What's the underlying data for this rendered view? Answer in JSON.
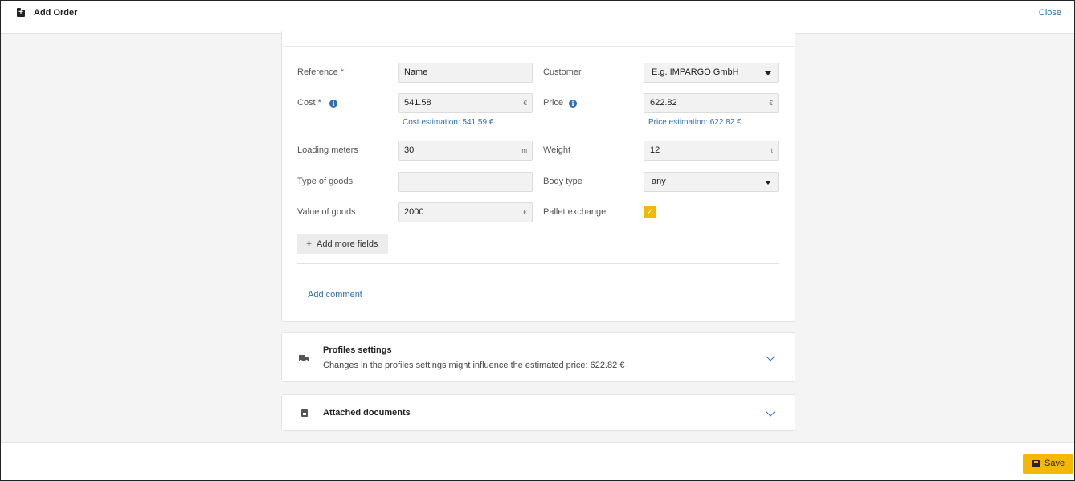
{
  "header": {
    "title": "Add Order",
    "close_label": "Close"
  },
  "form": {
    "reference": {
      "label": "Reference",
      "required_mark": "*",
      "value": "Name"
    },
    "customer": {
      "label": "Customer",
      "value": "E.g. IMPARGO GmbH"
    },
    "cost": {
      "label": "Cost",
      "required_mark": "*",
      "value": "541.58",
      "unit": "€",
      "estimation": "Cost estimation: 541.59 €"
    },
    "price": {
      "label": "Price",
      "value": "622.82",
      "unit": "€",
      "estimation": "Price estimation: 622.82 €"
    },
    "loading_meters": {
      "label": "Loading meters",
      "value": "30",
      "unit": "m"
    },
    "weight": {
      "label": "Weight",
      "value": "12",
      "unit": "t"
    },
    "type_of_goods": {
      "label": "Type of goods",
      "value": ""
    },
    "body_type": {
      "label": "Body type",
      "value": "any"
    },
    "value_of_goods": {
      "label": "Value of goods",
      "value": "2000",
      "unit": "€"
    },
    "pallet_exchange": {
      "label": "Pallet exchange",
      "checked": true,
      "check_glyph": "✓"
    },
    "info_glyph": "i",
    "add_more_fields_label": "Add more fields",
    "add_more_plus": "+",
    "add_comment_label": "Add comment"
  },
  "profiles": {
    "title": "Profiles settings",
    "subtitle": "Changes in the profiles settings might influence the estimated price: 622.82 €"
  },
  "documents": {
    "title": "Attached documents"
  },
  "footer": {
    "save_label": "Save"
  },
  "colors": {
    "accent": "#2d6fb5",
    "primary_button": "#f5b800"
  }
}
